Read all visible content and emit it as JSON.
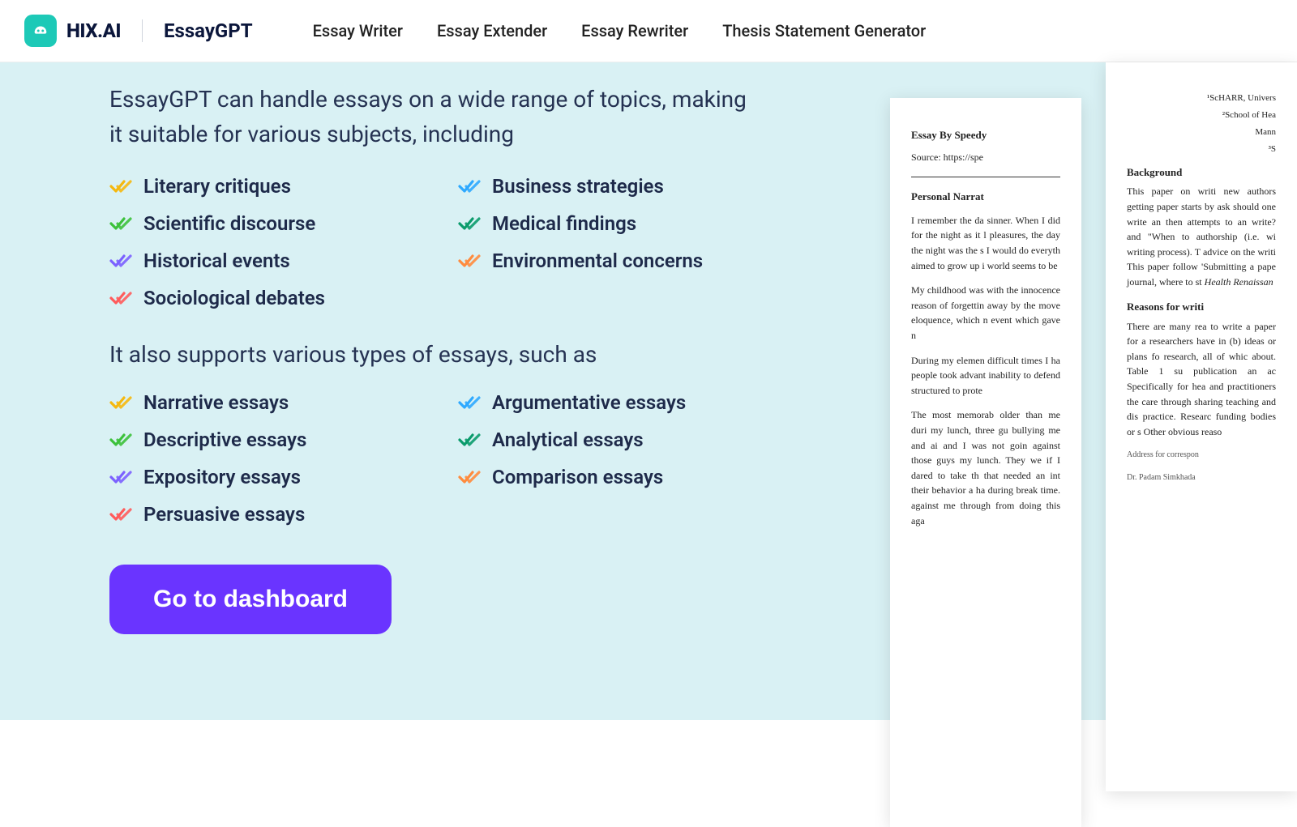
{
  "header": {
    "brand": "HIX.AI",
    "product": "EssayGPT",
    "nav": [
      "Essay Writer",
      "Essay Extender",
      "Essay Rewriter",
      "Thesis Statement Generator"
    ]
  },
  "hero": {
    "intro1": "EssayGPT can handle essays on a wide range of topics, making it suitable for various subjects, including",
    "topics_left": [
      {
        "label": "Literary critiques",
        "color": "#f5b80e"
      },
      {
        "label": "Scientific discourse",
        "color": "#3cc13b"
      },
      {
        "label": "Historical events",
        "color": "#7b61ff"
      },
      {
        "label": "Sociological debates",
        "color": "#ff5b5b"
      }
    ],
    "topics_right": [
      {
        "label": "Business strategies",
        "color": "#2ea9ff"
      },
      {
        "label": "Medical findings",
        "color": "#0a9b6b"
      },
      {
        "label": "Environmental concerns",
        "color": "#ff8b3d"
      }
    ],
    "intro2": "It also supports various types of essays, such as",
    "types_left": [
      {
        "label": "Narrative essays",
        "color": "#f5b80e"
      },
      {
        "label": "Descriptive essays",
        "color": "#3cc13b"
      },
      {
        "label": "Expository essays",
        "color": "#7b61ff"
      },
      {
        "label": "Persuasive essays",
        "color": "#ff5b5b"
      }
    ],
    "types_right": [
      {
        "label": "Argumentative essays",
        "color": "#2ea9ff"
      },
      {
        "label": "Analytical essays",
        "color": "#0a9b6b"
      },
      {
        "label": "Comparison essays",
        "color": "#ff8b3d"
      }
    ],
    "cta": "Go to dashboard"
  },
  "docA": {
    "title": "Essay By Speedy",
    "source": "Source: https://spe",
    "subtitle": "Personal Narrat",
    "p1": "I remember the da sinner. When I did for the night as it l pleasures, the day the night was the s I would do everyth aimed to grow up i world seems to be",
    "p2": "My childhood was with the innocence reason of forgettin away by the move eloquence, which n event which gave n",
    "p3": "During my elemen difficult times I ha people took advant inability to defend structured to prote",
    "p4": "The most memorab older than me duri my lunch, three gu bullying me and ai and I was not goin against those guys my lunch. They we if I dared to take th that needed an int their behavior a ha during break time. against me through from doing this aga"
  },
  "docB": {
    "aff1": "¹ScHARR, Univers",
    "aff2": "²School of Hea",
    "aff3": "Mann",
    "aff4": "³S",
    "h1": "Background",
    "p1": "This paper on writi new authors getting paper starts by ask should one write an then attempts to an write? and \"When to authorship (i.e. wi writing process). T advice on the writi This paper follow 'Submitting a pape journal, where to st",
    "it1": "Health Renaissan",
    "h2": "Reasons for writi",
    "p2": "There are many rea to write a paper for a researchers have in (b) ideas or plans fo research, all of whic about. Table 1 su publication an ac Specifically for hea and practitioners the care through sharing teaching and dis practice. Researc funding bodies or s Other obvious reaso",
    "small1": "Address for correspon",
    "small2": "Dr. Padam Simkhada"
  }
}
